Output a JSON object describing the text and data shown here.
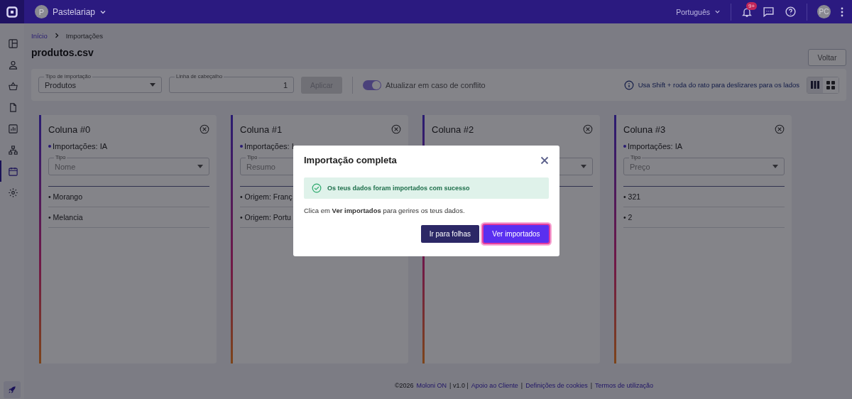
{
  "topbar": {
    "company_initial": "P",
    "company": "Pastelariap",
    "language": "Português",
    "notification_badge": "9+",
    "user_initials": "PC"
  },
  "sidebar": {
    "items": [
      {
        "selected": false
      },
      {
        "selected": false
      },
      {
        "selected": false
      },
      {
        "selected": false
      },
      {
        "selected": false
      },
      {
        "selected": false
      },
      {
        "selected": true
      },
      {
        "selected": false
      }
    ]
  },
  "breadcrumb": [
    {
      "label": "Início",
      "link": true
    },
    {
      "label": "Importações",
      "link": false
    }
  ],
  "title": "produtos.csv",
  "back_button": "Voltar",
  "toolbar": {
    "import_type": {
      "label": "Tipo de importação",
      "value": "Produtos"
    },
    "header_row": {
      "label": "Linha de cabeçalho",
      "value": "1"
    },
    "apply_button": {
      "label": "Aplicar",
      "disabled": true
    },
    "conflict_toggle": {
      "label": "Atualizar em caso de conflito",
      "on": true
    },
    "hint": "Usa Shift + roda do rato para deslizares para os lados",
    "views": [
      {
        "selected": true
      },
      {
        "selected": false
      }
    ]
  },
  "columns": [
    {
      "title": "Coluna #0",
      "source": "Importações: IA",
      "type_label": "Tipo",
      "type": "Nome",
      "values": [
        "• Morango",
        "• Melancia"
      ]
    },
    {
      "title": "Coluna #1",
      "source": "Importações: I",
      "type_label": "Tipo",
      "type": "Resumo",
      "values": [
        "• Origem: Franç",
        "• Origem: Portu"
      ]
    },
    {
      "title": "Coluna #2"
    },
    {
      "title": "Coluna #3",
      "source": "Importações: IA",
      "type_label": "Tipo",
      "type": "Preço",
      "values": [
        "• 321",
        "• 2"
      ]
    }
  ],
  "footer": [
    {
      "text": "©2026",
      "link": false
    },
    {
      "text": "Moloni ON",
      "link": true
    },
    {
      "text": "| v1.0 |",
      "link": false
    },
    {
      "text": "Apoio ao Cliente",
      "link": true
    },
    {
      "text": "|",
      "link": false
    },
    {
      "text": "Definições de cookies",
      "link": true
    },
    {
      "text": "|",
      "link": false
    },
    {
      "text": "Termos de utilização",
      "link": true
    }
  ],
  "modal": {
    "title": "Importação completa",
    "success": "Os teus dados foram importados com sucesso",
    "message": "Clica em **Ver importados** para gerires os teus dados.",
    "buttons": [
      {
        "label": "Ir para folhas",
        "kind": "secondary"
      },
      {
        "label": "Ver importados",
        "kind": "primary"
      }
    ]
  }
}
